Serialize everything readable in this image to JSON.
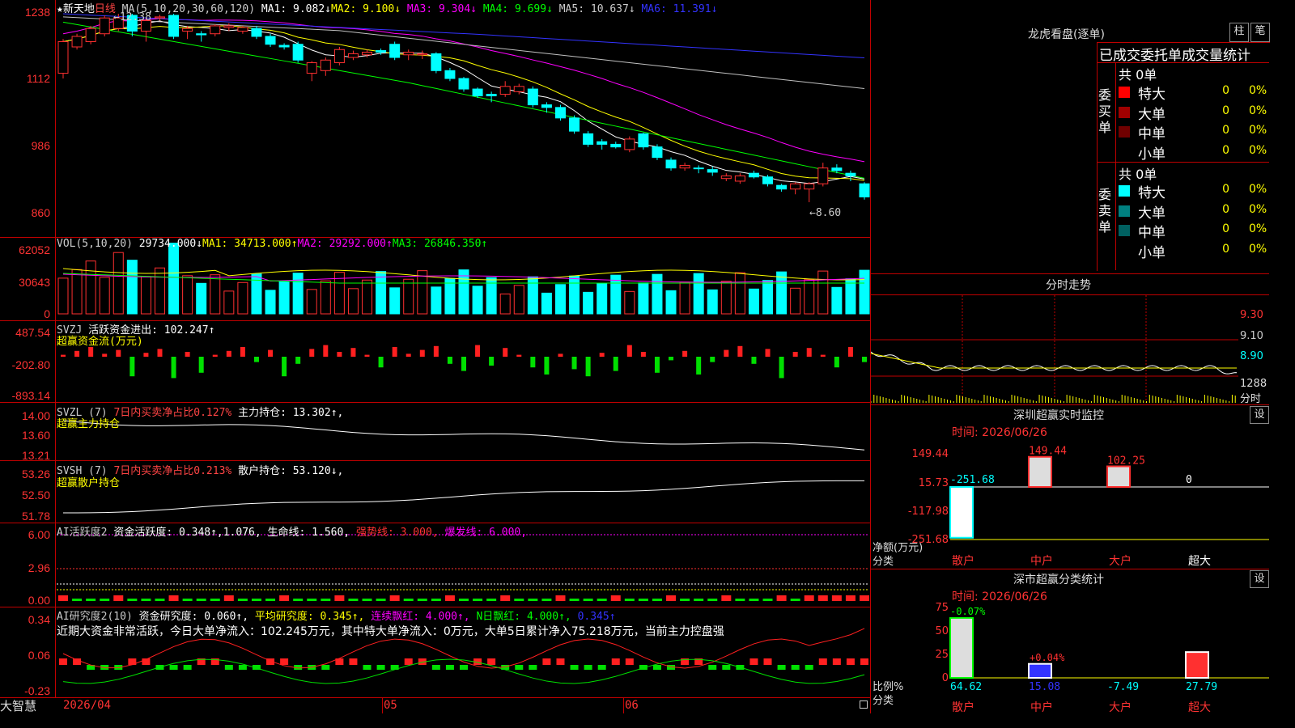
{
  "stock": {
    "name": "★新天地",
    "period": "日线"
  },
  "price_panel": {
    "ma_label": "MA(5,10,20,30,60,120)",
    "ma1": "MA1: 9.082↓",
    "ma2": "MA2: 9.100↓",
    "ma3": "MA3: 9.304↓",
    "ma4": "MA4: 9.699↓",
    "ma5": "MA5: 10.637↓",
    "ma6": "MA6: 11.391↓",
    "yticks": [
      "1238",
      "1112",
      "986",
      "860"
    ],
    "high_label": "←12.38",
    "low_label": "←8.60",
    "colors": {
      "ma1": "#ffffff",
      "ma2": "#ffff00",
      "ma3": "#ff00ff",
      "ma4": "#00ff00",
      "ma5": "#c0c0c0",
      "ma6": "#3333ff"
    }
  },
  "vol_panel": {
    "label": "VOL(5,10,20)",
    "value": "29734.000↓",
    "ma1": "MA1: 34713.000↑",
    "ma2": "MA2: 29292.000↑",
    "ma3": "MA3: 26846.350↑",
    "yticks": [
      "62052",
      "30643",
      "0"
    ]
  },
  "svzj_panel": {
    "label": "SVZJ",
    "title": "活跃资金进出: 102.247↑",
    "subtitle": "超赢资金流(万元)",
    "yticks": [
      "487.54",
      "-202.80",
      "-893.14"
    ]
  },
  "svzl_panel": {
    "label": "SVZL (7)",
    "pct": "7日内买卖净占比0.127%",
    "hold": "主力持仓: 13.302↑,",
    "subtitle": "超赢主力持仓",
    "yticks": [
      "14.00",
      "13.60",
      "13.21"
    ]
  },
  "svsh_panel": {
    "label": "SVSH (7)",
    "pct": "7日内买卖净占比0.213%",
    "hold": "散户持仓: 53.120↓,",
    "subtitle": "超赢散户持仓",
    "yticks": [
      "53.26",
      "52.50",
      "51.78"
    ]
  },
  "ai1_panel": {
    "label": "AI活跃度2",
    "a": "资金活跃度: 0.348↑,1.076,",
    "b": "生命线: 1.560,",
    "c": "强势线: 3.000,",
    "d": "爆发线: 6.000,",
    "yticks": [
      "6.00",
      "2.96",
      "0.00"
    ]
  },
  "ai2_panel": {
    "label": "AI研究度2(10)",
    "a": "资金研究度: 0.060↑,",
    "b": "平均研究度: 0.345↑,",
    "c": "连续飘红: 4.000↑,",
    "d": "N日飘红: 4.000↑,",
    "e": "0.345↑",
    "desc": "近期大资金非常活跃，今日大单净流入：102.245万元，其中特大单净流入：0万元，大单5日累计净入75.218万元，当前主力控盘强",
    "yticks": [
      "0.34",
      "0.06",
      "-0.23"
    ]
  },
  "bottom": {
    "brand": "大智慧",
    "date": "2026/04",
    "m5": "05",
    "m6": "06"
  },
  "right": {
    "lhb_title": "龙虎看盘(逐单)",
    "btn1": "柱",
    "btn2": "笔",
    "stats_title": "已成交委托单成交量统计",
    "buy_label": "委买单",
    "sell_label": "委卖单",
    "buy_total": "共 0单",
    "sell_total": "共 0单",
    "buy_rows": [
      {
        "name": "特大",
        "val": "0",
        "pct": "0%",
        "color": "#ff0000"
      },
      {
        "name": "大单",
        "val": "0",
        "pct": "0%",
        "color": "#a00000"
      },
      {
        "name": "中单",
        "val": "0",
        "pct": "0%",
        "color": "#700000"
      },
      {
        "name": "小单",
        "val": "0",
        "pct": "0%",
        "color": "#000000"
      }
    ],
    "sell_rows": [
      {
        "name": "特大",
        "val": "0",
        "pct": "0%",
        "color": "#00ffff"
      },
      {
        "name": "大单",
        "val": "0",
        "pct": "0%",
        "color": "#008080"
      },
      {
        "name": "中单",
        "val": "0",
        "pct": "0%",
        "color": "#006060"
      },
      {
        "name": "小单",
        "val": "0",
        "pct": "0%",
        "color": "#000000"
      }
    ],
    "fs_title": "分时走势",
    "fs_prices": [
      "9.30",
      "9.10",
      "8.90"
    ],
    "fs_vol": "1288",
    "fs_vol2": "分时",
    "mon_title": "深圳超赢实时监控",
    "mon_btn": "设",
    "mon_time": "时间: 2026/06/26",
    "mon_yticks": [
      "149.44",
      "15.73",
      "-117.98",
      "-251.68"
    ],
    "mon_vals": [
      "-251.68",
      "149.44",
      "102.25",
      "0"
    ],
    "mon_ylabel": "净额(万元)",
    "mon_xlabel": "分类",
    "cats": [
      "散户",
      "中户",
      "大户",
      "超大"
    ],
    "cls_title": "深市超赢分类统计",
    "cls_btn": "设",
    "cls_time": "时间: 2026/06/26",
    "cls_yticks": [
      "75",
      "50",
      "25",
      "0"
    ],
    "cls_top": [
      "-0.07%",
      "+0.04%"
    ],
    "cls_vals": [
      "64.62",
      "15.08",
      "-7.49",
      "27.79"
    ],
    "cls_ylabel": "比例%",
    "cls_xlabel": "分类"
  },
  "chart_data": {
    "type": "candlestick",
    "candles": [
      {
        "o": 1125,
        "c": 1185,
        "h": 1190,
        "l": 1115,
        "up": true
      },
      {
        "o": 1175,
        "c": 1195,
        "h": 1200,
        "l": 1170,
        "up": true
      },
      {
        "o": 1185,
        "c": 1210,
        "h": 1215,
        "l": 1180,
        "up": true
      },
      {
        "o": 1200,
        "c": 1230,
        "h": 1235,
        "l": 1195,
        "up": true
      },
      {
        "o": 1210,
        "c": 1230,
        "h": 1238,
        "l": 1205,
        "up": true
      },
      {
        "o": 1235,
        "c": 1205,
        "h": 1238,
        "l": 1195,
        "up": false
      },
      {
        "o": 1205,
        "c": 1225,
        "h": 1230,
        "l": 1185,
        "up": true
      },
      {
        "o": 1230,
        "c": 1232,
        "h": 1236,
        "l": 1225,
        "up": true
      },
      {
        "o": 1235,
        "c": 1195,
        "h": 1238,
        "l": 1190,
        "up": false
      },
      {
        "o": 1205,
        "c": 1210,
        "h": 1215,
        "l": 1190,
        "up": true
      },
      {
        "o": 1200,
        "c": 1198,
        "h": 1205,
        "l": 1185,
        "up": false
      },
      {
        "o": 1200,
        "c": 1215,
        "h": 1218,
        "l": 1195,
        "up": true
      },
      {
        "o": 1215,
        "c": 1212,
        "h": 1220,
        "l": 1205,
        "up": true
      },
      {
        "o": 1212,
        "c": 1205,
        "h": 1215,
        "l": 1200,
        "up": true
      },
      {
        "o": 1210,
        "c": 1195,
        "h": 1215,
        "l": 1190,
        "up": false
      },
      {
        "o": 1195,
        "c": 1180,
        "h": 1200,
        "l": 1175,
        "up": false
      },
      {
        "o": 1178,
        "c": 1175,
        "h": 1182,
        "l": 1170,
        "up": false
      },
      {
        "o": 1180,
        "c": 1150,
        "h": 1185,
        "l": 1145,
        "up": false
      },
      {
        "o": 1125,
        "c": 1145,
        "h": 1148,
        "l": 1110,
        "up": true
      },
      {
        "o": 1130,
        "c": 1150,
        "h": 1155,
        "l": 1120,
        "up": true
      },
      {
        "o": 1145,
        "c": 1170,
        "h": 1175,
        "l": 1140,
        "up": true
      },
      {
        "o": 1155,
        "c": 1162,
        "h": 1168,
        "l": 1150,
        "up": true
      },
      {
        "o": 1160,
        "c": 1165,
        "h": 1170,
        "l": 1155,
        "up": true
      },
      {
        "o": 1165,
        "c": 1168,
        "h": 1172,
        "l": 1160,
        "up": false
      },
      {
        "o": 1180,
        "c": 1155,
        "h": 1185,
        "l": 1150,
        "up": false
      },
      {
        "o": 1160,
        "c": 1165,
        "h": 1170,
        "l": 1150,
        "up": true
      },
      {
        "o": 1160,
        "c": 1162,
        "h": 1168,
        "l": 1152,
        "up": true
      },
      {
        "o": 1162,
        "c": 1130,
        "h": 1165,
        "l": 1125,
        "up": false
      },
      {
        "o": 1130,
        "c": 1115,
        "h": 1135,
        "l": 1110,
        "up": false
      },
      {
        "o": 1115,
        "c": 1095,
        "h": 1118,
        "l": 1090,
        "up": false
      },
      {
        "o": 1095,
        "c": 1082,
        "h": 1098,
        "l": 1078,
        "up": false
      },
      {
        "o": 1085,
        "c": 1082,
        "h": 1090,
        "l": 1070,
        "up": false
      },
      {
        "o": 1085,
        "c": 1100,
        "h": 1110,
        "l": 1080,
        "up": true
      },
      {
        "o": 1100,
        "c": 1090,
        "h": 1105,
        "l": 1085,
        "up": true
      },
      {
        "o": 1095,
        "c": 1065,
        "h": 1100,
        "l": 1060,
        "up": false
      },
      {
        "o": 1065,
        "c": 1060,
        "h": 1070,
        "l": 1050,
        "up": false
      },
      {
        "o": 1060,
        "c": 1040,
        "h": 1065,
        "l": 1035,
        "up": false
      },
      {
        "o": 1040,
        "c": 1015,
        "h": 1045,
        "l": 1010,
        "up": false
      },
      {
        "o": 1010,
        "c": 990,
        "h": 1015,
        "l": 985,
        "up": false
      },
      {
        "o": 995,
        "c": 990,
        "h": 1000,
        "l": 980,
        "up": false
      },
      {
        "o": 990,
        "c": 985,
        "h": 995,
        "l": 982,
        "up": false
      },
      {
        "o": 980,
        "c": 1000,
        "h": 1005,
        "l": 975,
        "up": true
      },
      {
        "o": 1010,
        "c": 985,
        "h": 1012,
        "l": 980,
        "up": false
      },
      {
        "o": 985,
        "c": 965,
        "h": 990,
        "l": 960,
        "up": false
      },
      {
        "o": 960,
        "c": 945,
        "h": 965,
        "l": 940,
        "up": false
      },
      {
        "o": 945,
        "c": 950,
        "h": 955,
        "l": 940,
        "up": true
      },
      {
        "o": 945,
        "c": 945,
        "h": 950,
        "l": 935,
        "up": false
      },
      {
        "o": 942,
        "c": 937,
        "h": 948,
        "l": 930,
        "up": false
      },
      {
        "o": 930,
        "c": 925,
        "h": 935,
        "l": 920,
        "up": true
      },
      {
        "o": 920,
        "c": 930,
        "h": 935,
        "l": 915,
        "up": true
      },
      {
        "o": 935,
        "c": 928,
        "h": 940,
        "l": 925,
        "up": false
      },
      {
        "o": 928,
        "c": 915,
        "h": 932,
        "l": 910,
        "up": false
      },
      {
        "o": 912,
        "c": 905,
        "h": 915,
        "l": 900,
        "up": false
      },
      {
        "o": 905,
        "c": 915,
        "h": 918,
        "l": 895,
        "up": true
      },
      {
        "o": 905,
        "c": 915,
        "h": 918,
        "l": 880,
        "up": true
      },
      {
        "o": 915,
        "c": 945,
        "h": 955,
        "l": 910,
        "up": true
      },
      {
        "o": 945,
        "c": 940,
        "h": 952,
        "l": 935,
        "up": false
      },
      {
        "o": 935,
        "c": 930,
        "h": 940,
        "l": 920,
        "up": false
      },
      {
        "o": 915,
        "c": 890,
        "h": 918,
        "l": 885,
        "up": false
      }
    ]
  }
}
